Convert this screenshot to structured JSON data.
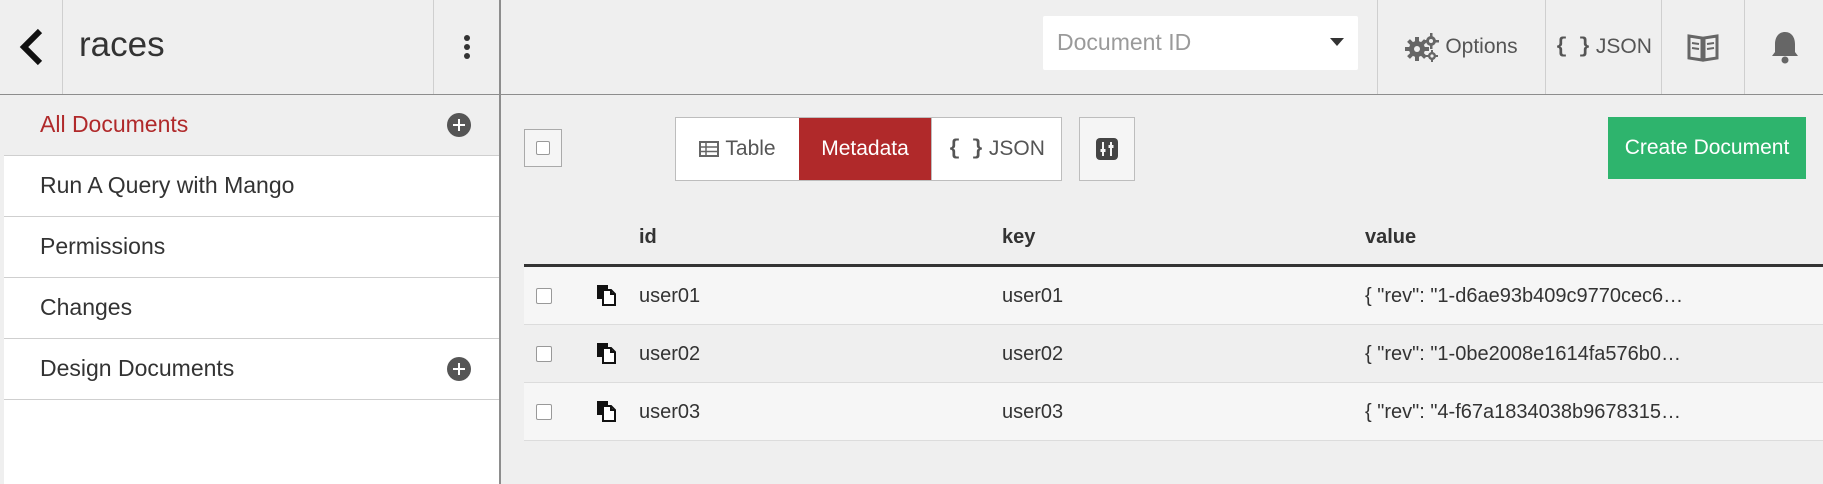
{
  "header": {
    "db_name": "races",
    "doc_id_placeholder": "Document ID",
    "options_label": "Options",
    "json_label": "JSON",
    "braces": "{ }"
  },
  "sidebar": {
    "items": [
      {
        "label": "All Documents",
        "active": true,
        "has_add": true
      },
      {
        "label": "Run A Query with Mango",
        "active": false,
        "has_add": false
      },
      {
        "label": "Permissions",
        "active": false,
        "has_add": false
      },
      {
        "label": "Changes",
        "active": false,
        "has_add": false
      },
      {
        "label": "Design Documents",
        "active": false,
        "has_add": true
      }
    ]
  },
  "toolbar": {
    "view_table": "Table",
    "view_metadata": "Metadata",
    "view_json": "JSON",
    "braces": "{ }",
    "active_view": "Metadata",
    "create_document": "Create Document"
  },
  "table": {
    "columns": [
      "id",
      "key",
      "value"
    ],
    "rows": [
      {
        "id": "user01",
        "key": "user01",
        "value": "{ \"rev\": \"1-d6ae93b409c9770cec6…"
      },
      {
        "id": "user02",
        "key": "user02",
        "value": "{ \"rev\": \"1-0be2008e1614fa576b0…"
      },
      {
        "id": "user03",
        "key": "user03",
        "value": "{ \"rev\": \"4-f67a1834038b9678315…"
      }
    ]
  },
  "colors": {
    "accent_red": "#b0292a",
    "create_green": "#2eb46d",
    "background": "#efefef"
  },
  "icons": {
    "back": "chevron-left-icon",
    "menu": "kebab-icon",
    "options": "gears-icon",
    "docs": "book-icon",
    "notifications": "bell-icon",
    "table": "table-icon",
    "columns": "sliders-icon",
    "row_doc": "copy-doc-icon",
    "add": "plus-circle-icon"
  }
}
